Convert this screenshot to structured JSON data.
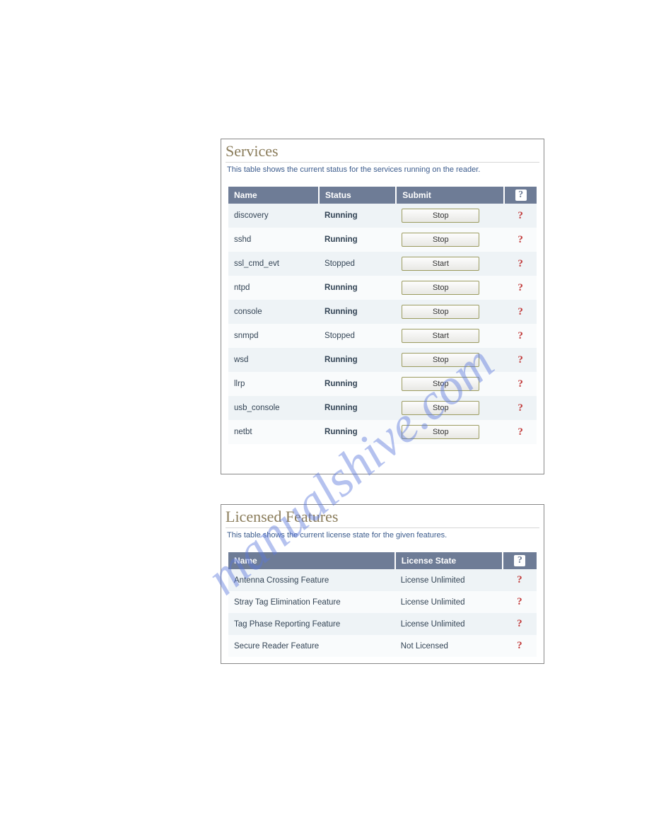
{
  "watermark": "manualshive.com",
  "services_panel": {
    "title": "Services",
    "description": "This table shows the current status for the services running on the reader.",
    "columns": {
      "name": "Name",
      "status": "Status",
      "submit": "Submit"
    },
    "rows": [
      {
        "name": "discovery",
        "status": "Running",
        "action": "Stop"
      },
      {
        "name": "sshd",
        "status": "Running",
        "action": "Stop"
      },
      {
        "name": "ssl_cmd_evt",
        "status": "Stopped",
        "action": "Start"
      },
      {
        "name": "ntpd",
        "status": "Running",
        "action": "Stop"
      },
      {
        "name": "console",
        "status": "Running",
        "action": "Stop"
      },
      {
        "name": "snmpd",
        "status": "Stopped",
        "action": "Start"
      },
      {
        "name": "wsd",
        "status": "Running",
        "action": "Stop"
      },
      {
        "name": "llrp",
        "status": "Running",
        "action": "Stop"
      },
      {
        "name": "usb_console",
        "status": "Running",
        "action": "Stop"
      },
      {
        "name": "netbt",
        "status": "Running",
        "action": "Stop"
      }
    ]
  },
  "features_panel": {
    "title": "Licensed Features",
    "description": "This table shows the current license state for the given features.",
    "columns": {
      "name": "Name",
      "state": "License State"
    },
    "rows": [
      {
        "name": "Antenna Crossing Feature",
        "state": "License Unlimited"
      },
      {
        "name": "Stray Tag Elimination Feature",
        "state": "License Unlimited"
      },
      {
        "name": "Tag Phase Reporting Feature",
        "state": "License Unlimited"
      },
      {
        "name": "Secure Reader Feature",
        "state": "Not Licensed"
      }
    ]
  },
  "help_glyph": "?"
}
